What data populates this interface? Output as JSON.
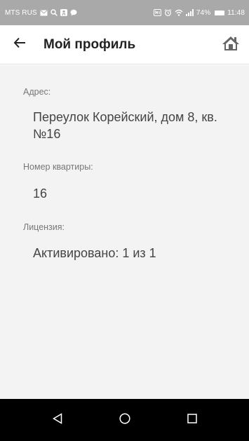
{
  "status_bar": {
    "carrier": "MTS RUS",
    "battery_percent": "74%",
    "time": "11:48",
    "icons": [
      "sms-icon",
      "search-icon",
      "odnoklassniki-icon",
      "chat-bubble-icon",
      "nfc-icon",
      "alarm-icon",
      "wifi-icon",
      "signal-icon",
      "battery-icon"
    ]
  },
  "app_bar": {
    "title": "Мой профиль",
    "back_icon": "arrow-left-icon",
    "home_icon": "home-icon"
  },
  "profile": {
    "address_label": "Адрес:",
    "address_value": "Переулок Корейский, дом 8, кв. №16",
    "apartment_label": "Номер квартиры:",
    "apartment_value": "16",
    "license_label": "Лицензия:",
    "license_value": "Активировано: 1 из 1"
  },
  "nav_bar": {
    "buttons": [
      "back-triangle-icon",
      "home-circle-icon",
      "recents-square-icon"
    ]
  },
  "colors": {
    "status_bar_bg": "#a9a9a9",
    "content_bg": "#f3f3f3",
    "nav_bar_bg": "#000000"
  }
}
